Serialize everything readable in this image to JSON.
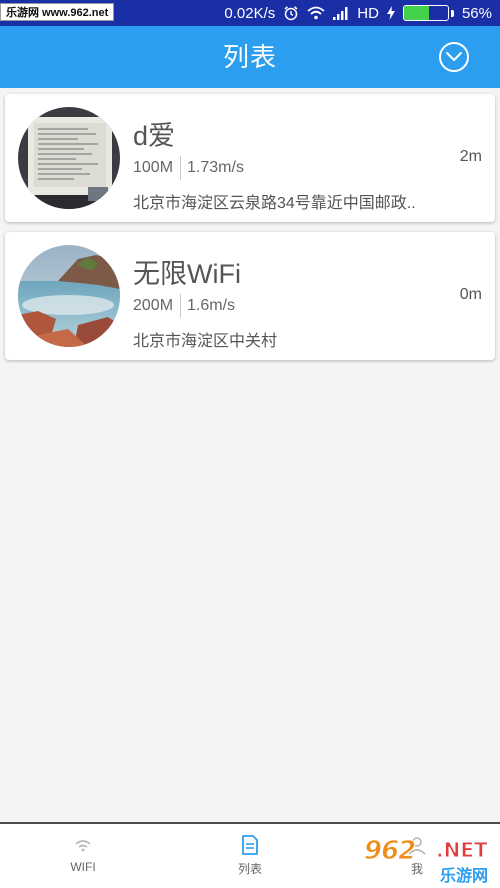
{
  "status_bar": {
    "watermark": "乐游网 www.962.net",
    "net_speed": "0.02K/s",
    "hd": "HD",
    "battery": "56%",
    "battery_level": 0.56,
    "battery_color": "#43d04b"
  },
  "header": {
    "title": "列表",
    "dropdown_icon": "chevron-down-circle-icon",
    "bg_color": "#2b9ef0"
  },
  "networks": [
    {
      "name": "d爱",
      "bandwidth": "100M",
      "speed": "1.73m/s",
      "address": "北京市海淀区云泉路34号靠近中国邮政..",
      "distance": "2m",
      "image": "monitor-photo"
    },
    {
      "name": "无限WiFi",
      "bandwidth": "200M",
      "speed": "1.6m/s",
      "address": "北京市海淀区中关村",
      "distance": "0m",
      "image": "seascape-photo"
    }
  ],
  "bottom_nav": {
    "wifi_label": "WIFI",
    "list_label": "列表",
    "me_label": "我",
    "active": "列表"
  },
  "watermark_bottom": {
    "number": "962",
    "net": ".NET",
    "site": "乐游网"
  }
}
